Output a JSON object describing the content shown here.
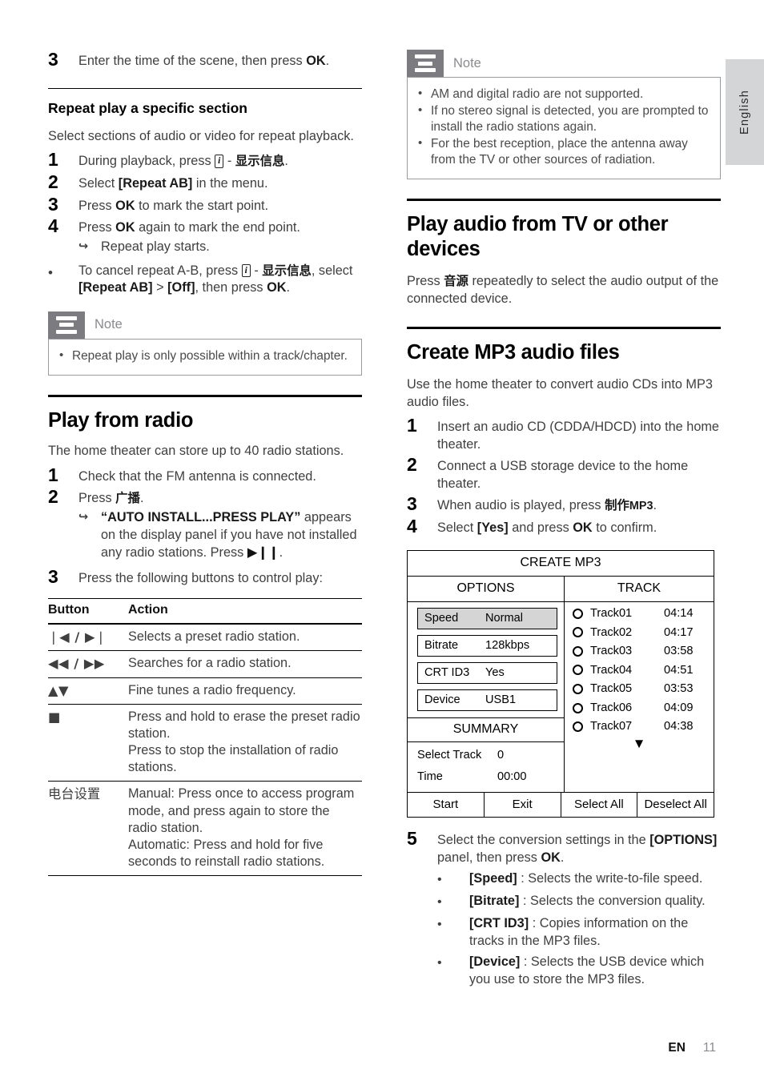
{
  "page": {
    "language_tab": "English",
    "footer_lang": "EN",
    "footer_page": "11"
  },
  "left_column": {
    "intro_step": {
      "num": "3",
      "text_a": "Enter the time of the scene, then press ",
      "bold": "OK",
      "text_b": "."
    },
    "repeat_section": {
      "heading": "Repeat play a specific section",
      "intro": "Select sections of audio or video for repeat playback.",
      "steps": [
        {
          "num": "1",
          "a": "During playback, press ",
          "key": "i",
          "b": " - ",
          "cjk": "显示信息",
          "c": "."
        },
        {
          "num": "2",
          "a": "Select ",
          "bold": "[Repeat AB]",
          "b": " in the menu."
        },
        {
          "num": "3",
          "a": "Press ",
          "bold": "OK",
          "b": " to mark the start point."
        },
        {
          "num": "4",
          "a": "Press ",
          "bold": "OK",
          "b": " again to mark the end point."
        }
      ],
      "result": "Repeat play starts.",
      "bullet": {
        "a": "To cancel repeat A-B, press ",
        "key": "i",
        "b": " - ",
        "cjk": "显示信息",
        "c": ", select ",
        "bold1": "[Repeat AB]",
        "d": " > ",
        "bold2": "[Off]",
        "e": ", then press ",
        "bold3": "OK",
        "f": "."
      },
      "note": {
        "label": "Note",
        "items": [
          "Repeat play is only possible within a track/chapter."
        ]
      }
    },
    "radio_section": {
      "heading": "Play from radio",
      "intro": "The home theater can store up to 40 radio stations.",
      "steps": [
        {
          "num": "1",
          "text": "Check that the FM antenna is connected."
        },
        {
          "num": "2",
          "a": "Press ",
          "cjk": "广播",
          "b": "."
        },
        {
          "num": "3",
          "text": "Press the following buttons to control play:"
        }
      ],
      "step2_result": {
        "quote": "“AUTO INSTALL...PRESS PLAY”",
        "a": " appears on the display panel if you have not installed any radio stations. Press ",
        "symbol": "▶❙❙",
        "b": "."
      },
      "table": {
        "headers": [
          "Button",
          "Action"
        ],
        "rows": [
          {
            "button": "❘◀ / ▶❘",
            "action": "Selects a preset radio station."
          },
          {
            "button": "◀◀ / ▶▶",
            "action": "Searches for a radio station."
          },
          {
            "button": "▲▼",
            "action": "Fine tunes a radio frequency."
          },
          {
            "button": "■",
            "action": "Press and hold to erase the preset radio station.\nPress to stop the installation of radio stations."
          },
          {
            "button": "电台设置",
            "button_is_cjk": true,
            "action": "Manual: Press once to access program mode, and press again to store the radio station.\nAutomatic: Press and hold for five seconds to reinstall radio stations."
          }
        ]
      }
    }
  },
  "right_column": {
    "radio_note": {
      "label": "Note",
      "items": [
        "AM and digital radio are not supported.",
        "If no stereo signal is detected, you are prompted to install the radio stations again.",
        "For the best reception, place the antenna away from the TV or other sources of radiation."
      ]
    },
    "tv_audio_section": {
      "heading": "Play audio from TV or other devices",
      "body_a": "Press ",
      "body_cjk": "音源",
      "body_b": " repeatedly to select the audio output of the connected device."
    },
    "mp3_section": {
      "heading": "Create MP3 audio files",
      "intro": "Use the home theater to convert audio CDs into MP3 audio files.",
      "steps": [
        {
          "num": "1",
          "text": "Insert an audio CD (CDDA/HDCD) into the home theater."
        },
        {
          "num": "2",
          "text": "Connect a USB storage device to the home theater."
        },
        {
          "num": "3",
          "a": "When audio is played, press ",
          "cjk": "制作",
          "mp3": "MP3",
          "b": "."
        },
        {
          "num": "4",
          "a": "Select ",
          "bold1": "[Yes]",
          "b": " and press ",
          "bold2": "OK",
          "c": " to confirm."
        }
      ],
      "step5": {
        "num": "5",
        "a": "Select the conversion settings in the ",
        "bold1": "[OPTIONS]",
        "b": " panel, then press ",
        "bold2": "OK",
        "c": ".",
        "bullets": [
          {
            "term": "[Speed]",
            "desc": " : Selects the write-to-file speed."
          },
          {
            "term": "[Bitrate]",
            "desc": " : Selects the conversion quality."
          },
          {
            "term": "[CRT ID3]",
            "desc": " : Copies information on the tracks in the MP3 files."
          },
          {
            "term": "[Device]",
            "desc": " : Selects the USB device which you use to store the MP3 files."
          }
        ]
      }
    },
    "mp3_dialog": {
      "title": "CREATE MP3",
      "options_header": "OPTIONS",
      "track_header": "TRACK",
      "options": [
        {
          "key": "Speed",
          "value": "Normal",
          "selected": true
        },
        {
          "key": "Bitrate",
          "value": "128kbps",
          "selected": false
        },
        {
          "key": "CRT ID3",
          "value": "Yes",
          "selected": false
        },
        {
          "key": "Device",
          "value": "USB1",
          "selected": false
        }
      ],
      "summary_header": "SUMMARY",
      "summary": [
        {
          "key": "Select Track",
          "value": "0"
        },
        {
          "key": "Time",
          "value": "00:00"
        }
      ],
      "tracks": [
        {
          "name": "Track01",
          "time": "04:14"
        },
        {
          "name": "Track02",
          "time": "04:17"
        },
        {
          "name": "Track03",
          "time": "03:58"
        },
        {
          "name": "Track04",
          "time": "04:51"
        },
        {
          "name": "Track05",
          "time": "03:53"
        },
        {
          "name": "Track06",
          "time": "04:09"
        },
        {
          "name": "Track07",
          "time": "04:38"
        }
      ],
      "scroll_indicator": "▼",
      "buttons_left": [
        "Start",
        "Exit"
      ],
      "buttons_right": [
        "Select All",
        "Deselect All"
      ]
    }
  }
}
